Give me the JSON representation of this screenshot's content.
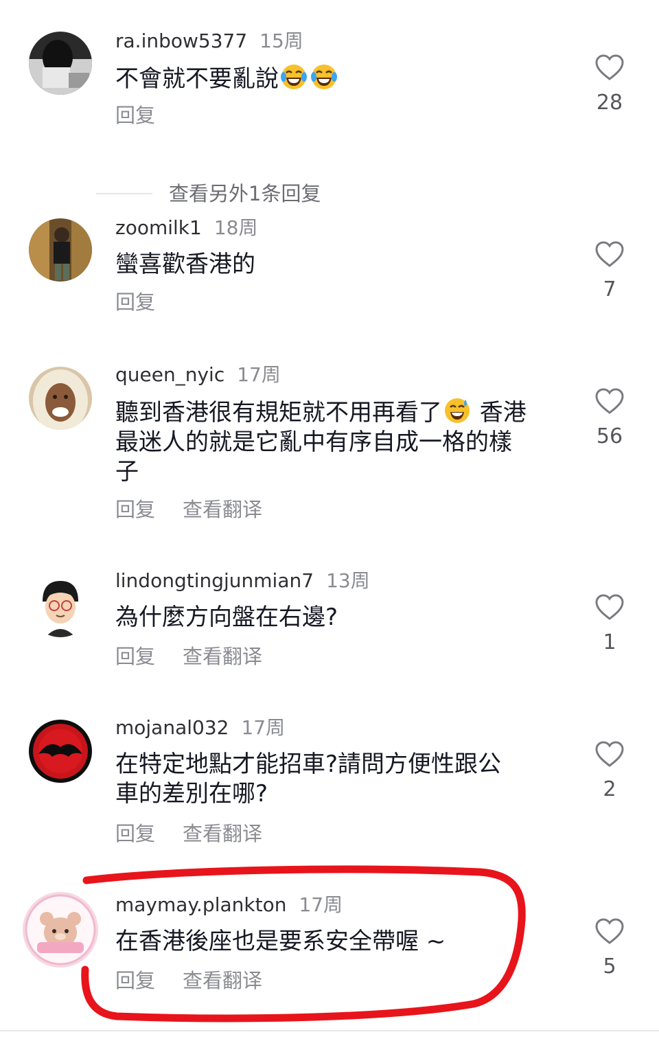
{
  "comments": [
    {
      "username": "ra.inbow5377",
      "time": "15周",
      "text": "不會就不要亂說",
      "reply_label": "回复",
      "likes": "28",
      "view_more": "查看另外1条回复"
    },
    {
      "username": "zoomilk1",
      "time": "18周",
      "text": "蠻喜歡香港的",
      "reply_label": "回复",
      "likes": "7"
    },
    {
      "username": "queen_nyic",
      "time": "17周",
      "text_line1": "聽到香港很有規矩就不用再看了",
      "text_line1b": " 香港",
      "text_line2": "最迷人的就是它亂中有序自成一格的樣",
      "text_line3": "子",
      "reply_label": "回复",
      "translate_label": "查看翻译",
      "likes": "56"
    },
    {
      "username": "lindongtingjunmian7",
      "time": "13周",
      "text": "為什麼方向盤在右邊?",
      "reply_label": "回复",
      "translate_label": "查看翻译",
      "likes": "1"
    },
    {
      "username": "mojanal032",
      "time": "17周",
      "text_line1": "在特定地點才能招車?請問方便性跟公",
      "text_line2": "車的差別在哪?",
      "reply_label": "回复",
      "translate_label": "查看翻译",
      "likes": "2"
    },
    {
      "username": "maymay.plankton",
      "time": "17周",
      "text": "在香港後座也是要系安全帶喔 ~",
      "reply_label": "回复",
      "translate_label": "查看翻译",
      "likes": "5"
    }
  ],
  "colors": {
    "highlight_stroke": "#e8141b",
    "text_primary": "#161823",
    "text_secondary": "#8a8b91"
  },
  "icons": [
    "heart-outline-icon",
    "laughing-crying-emoji",
    "sweat-smile-emoji"
  ]
}
